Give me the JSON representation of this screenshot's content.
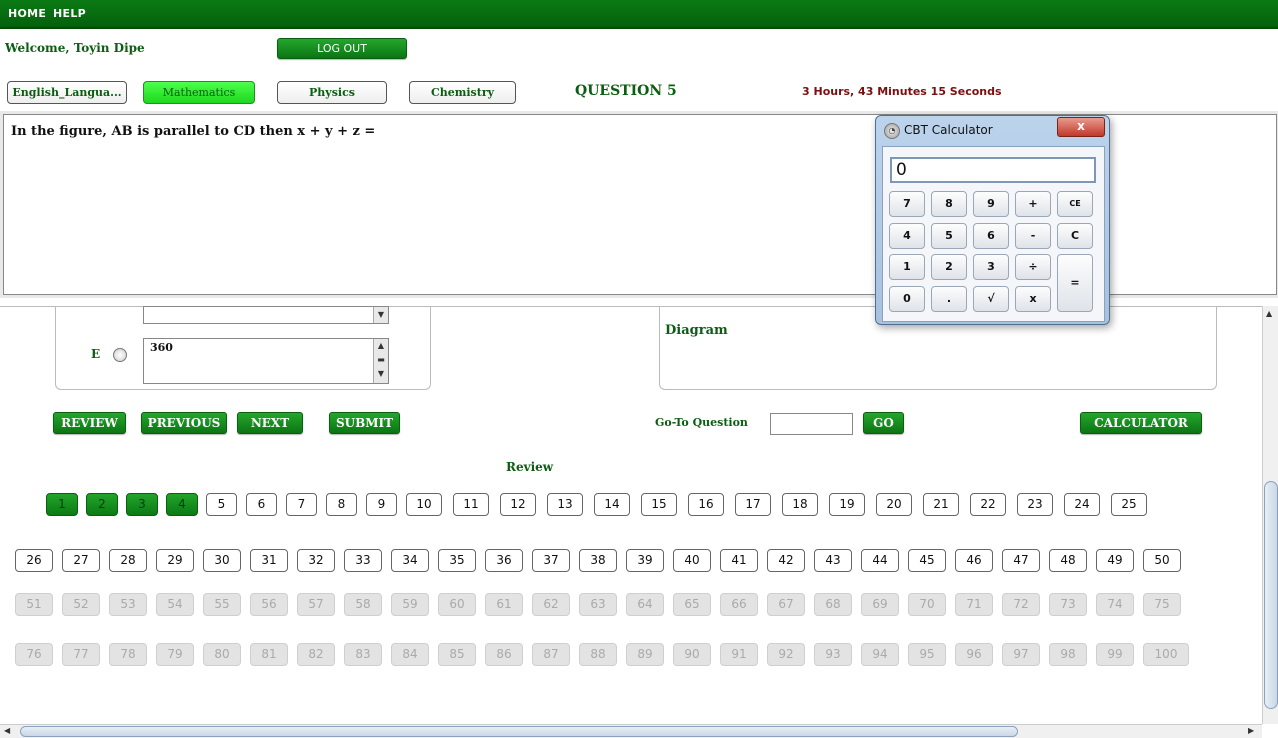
{
  "nav": {
    "home": "HOME",
    "help": "HELP"
  },
  "welcome": "Welcome, Toyin Dipe",
  "logout": "LOG OUT",
  "subjects": [
    "English_Langua...",
    "Mathematics",
    "Physics",
    "Chemistry"
  ],
  "active_subject": "Mathematics",
  "question_label": "QUESTION 5",
  "timer": "3 Hours, 43 Minutes 15 Seconds",
  "question_text": "In the figure, AB is parallel to CD then x + y + z =",
  "option_e": {
    "label": "E",
    "value": "360"
  },
  "diagram_label": "Diagram",
  "buttons": {
    "review": "REVIEW",
    "previous": "PREVIOUS",
    "next": "NEXT",
    "submit": "SUBMIT",
    "go": "GO",
    "calculator": "CALCULATOR"
  },
  "goto_label": "Go-To Question",
  "review_label": "Review",
  "question_grid": {
    "total": 100,
    "answered": [
      1,
      2,
      3,
      4
    ],
    "enabled_upto": 50
  },
  "calculator": {
    "title": "CBT Calculator",
    "close": "x",
    "display": "0",
    "keys": [
      [
        "7",
        "8",
        "9",
        "+",
        "CE"
      ],
      [
        "4",
        "5",
        "6",
        "-",
        "C"
      ],
      [
        "1",
        "2",
        "3",
        "÷",
        "="
      ],
      [
        "0",
        ".",
        "√",
        "x"
      ]
    ]
  },
  "colors": {
    "accent_green": "#0b7a14",
    "timer_red": "#7a0f0f",
    "active_tab": "#1ed71e"
  }
}
